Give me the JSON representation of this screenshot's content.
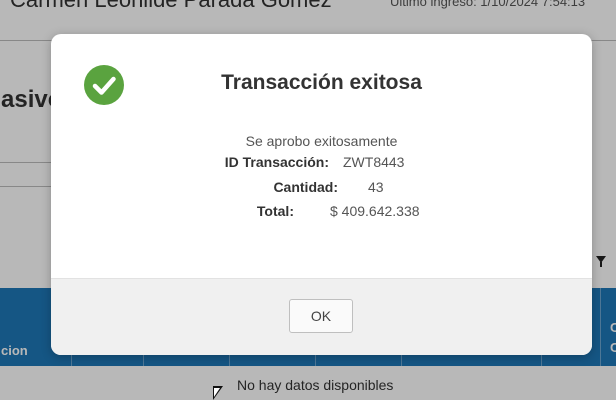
{
  "background": {
    "user_name": "Carmen Leonilde Parada Gomez",
    "last_login": "Último ingreso: 1/10/2024 7:54:13",
    "section_title": "asivo",
    "column_accion": "cion",
    "column_right": "C C",
    "empty_message": "No hay datos disponibles",
    "header_color": "#1e78b8"
  },
  "modal": {
    "icon": "check-circle-icon",
    "icon_color": "#5aa33f",
    "title": "Transacción exitosa",
    "message": "Se aprobo exitosamente",
    "id_label": "ID Transacción:",
    "id_value": "ZWT8443",
    "qty_label": "Cantidad:",
    "qty_value": "43",
    "total_label": "Total:",
    "total_value": "$ 409.642.338",
    "ok_label": "OK"
  }
}
